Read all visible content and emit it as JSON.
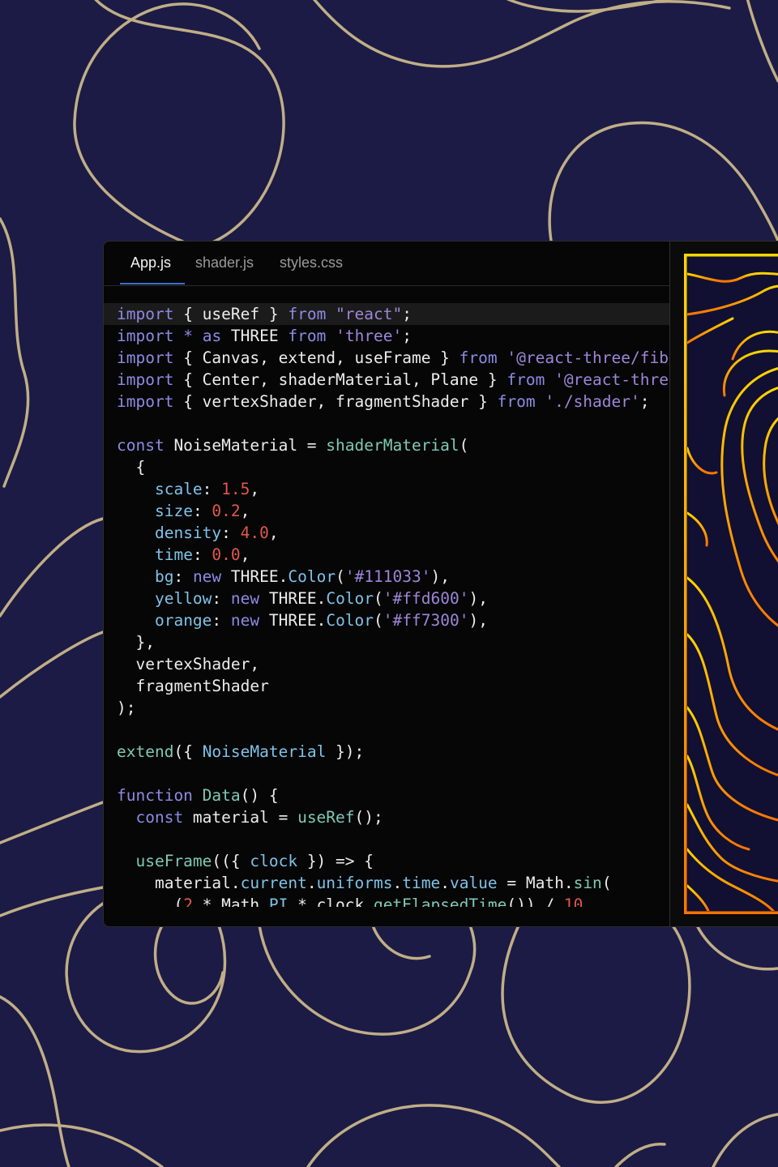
{
  "colors": {
    "background": "#1b1b45",
    "contour_line": "#c9b68a",
    "preview_bg": "#111033",
    "preview_yellow": "#ffd600",
    "preview_orange": "#ff7300"
  },
  "editor": {
    "tabs": [
      {
        "label": "App.js",
        "active": true
      },
      {
        "label": "shader.js",
        "active": false
      },
      {
        "label": "styles.css",
        "active": false
      }
    ],
    "code_lines": [
      [
        [
          "kw",
          "import"
        ],
        [
          "id",
          " { useRef } "
        ],
        [
          "kw",
          "from"
        ],
        [
          "id",
          " "
        ],
        [
          "str",
          "\"react\""
        ],
        [
          "id",
          ";"
        ]
      ],
      [
        [
          "kw",
          "import"
        ],
        [
          "id",
          " "
        ],
        [
          "kw",
          "*"
        ],
        [
          "id",
          " "
        ],
        [
          "kw",
          "as"
        ],
        [
          "id",
          " THREE "
        ],
        [
          "kw",
          "from"
        ],
        [
          "id",
          " "
        ],
        [
          "str",
          "'three'"
        ],
        [
          "id",
          ";"
        ]
      ],
      [
        [
          "kw",
          "import"
        ],
        [
          "id",
          " { Canvas, extend, useFrame } "
        ],
        [
          "kw",
          "from"
        ],
        [
          "id",
          " "
        ],
        [
          "str",
          "'@react-three/fiber'"
        ],
        [
          "id",
          ";"
        ]
      ],
      [
        [
          "kw",
          "import"
        ],
        [
          "id",
          " { Center, shaderMaterial, Plane } "
        ],
        [
          "kw",
          "from"
        ],
        [
          "id",
          " "
        ],
        [
          "str",
          "'@react-three/drei'"
        ],
        [
          "id",
          ";"
        ]
      ],
      [
        [
          "kw",
          "import"
        ],
        [
          "id",
          " { vertexShader, fragmentShader } "
        ],
        [
          "kw",
          "from"
        ],
        [
          "id",
          " "
        ],
        [
          "str",
          "'./shader'"
        ],
        [
          "id",
          ";"
        ]
      ],
      [],
      [
        [
          "kw",
          "const"
        ],
        [
          "id",
          " NoiseMaterial = "
        ],
        [
          "fn",
          "shaderMaterial"
        ],
        [
          "id",
          "("
        ]
      ],
      [
        [
          "id",
          "  {"
        ]
      ],
      [
        [
          "id",
          "    "
        ],
        [
          "prop",
          "scale"
        ],
        [
          "id",
          ": "
        ],
        [
          "num",
          "1.5"
        ],
        [
          "id",
          ","
        ]
      ],
      [
        [
          "id",
          "    "
        ],
        [
          "prop",
          "size"
        ],
        [
          "id",
          ": "
        ],
        [
          "num",
          "0.2"
        ],
        [
          "id",
          ","
        ]
      ],
      [
        [
          "id",
          "    "
        ],
        [
          "prop",
          "density"
        ],
        [
          "id",
          ": "
        ],
        [
          "num",
          "4.0"
        ],
        [
          "id",
          ","
        ]
      ],
      [
        [
          "id",
          "    "
        ],
        [
          "prop",
          "time"
        ],
        [
          "id",
          ": "
        ],
        [
          "num",
          "0.0"
        ],
        [
          "id",
          ","
        ]
      ],
      [
        [
          "id",
          "    "
        ],
        [
          "prop",
          "bg"
        ],
        [
          "id",
          ": "
        ],
        [
          "kw",
          "new"
        ],
        [
          "id",
          " THREE."
        ],
        [
          "prop",
          "Color"
        ],
        [
          "id",
          "("
        ],
        [
          "str",
          "'#111033'"
        ],
        [
          "id",
          "),"
        ]
      ],
      [
        [
          "id",
          "    "
        ],
        [
          "prop",
          "yellow"
        ],
        [
          "id",
          ": "
        ],
        [
          "kw",
          "new"
        ],
        [
          "id",
          " THREE."
        ],
        [
          "prop",
          "Color"
        ],
        [
          "id",
          "("
        ],
        [
          "str",
          "'#ffd600'"
        ],
        [
          "id",
          "),"
        ]
      ],
      [
        [
          "id",
          "    "
        ],
        [
          "prop",
          "orange"
        ],
        [
          "id",
          ": "
        ],
        [
          "kw",
          "new"
        ],
        [
          "id",
          " THREE."
        ],
        [
          "prop",
          "Color"
        ],
        [
          "id",
          "("
        ],
        [
          "str",
          "'#ff7300'"
        ],
        [
          "id",
          "),"
        ]
      ],
      [
        [
          "id",
          "  },"
        ]
      ],
      [
        [
          "id",
          "  vertexShader,"
        ]
      ],
      [
        [
          "id",
          "  fragmentShader"
        ]
      ],
      [
        [
          "id",
          ");"
        ]
      ],
      [],
      [
        [
          "fn",
          "extend"
        ],
        [
          "id",
          "({ "
        ],
        [
          "prop",
          "NoiseMaterial"
        ],
        [
          "id",
          " });"
        ]
      ],
      [],
      [
        [
          "kw",
          "function"
        ],
        [
          "id",
          " "
        ],
        [
          "fn",
          "Data"
        ],
        [
          "id",
          "() {"
        ]
      ],
      [
        [
          "id",
          "  "
        ],
        [
          "kw",
          "const"
        ],
        [
          "id",
          " material = "
        ],
        [
          "fn",
          "useRef"
        ],
        [
          "id",
          "();"
        ]
      ],
      [],
      [
        [
          "id",
          "  "
        ],
        [
          "fn",
          "useFrame"
        ],
        [
          "id",
          "(({ "
        ],
        [
          "prop",
          "clock"
        ],
        [
          "id",
          " }) => {"
        ]
      ],
      [
        [
          "id",
          "    material."
        ],
        [
          "prop",
          "current"
        ],
        [
          "id",
          "."
        ],
        [
          "prop",
          "uniforms"
        ],
        [
          "id",
          "."
        ],
        [
          "prop",
          "time"
        ],
        [
          "id",
          "."
        ],
        [
          "prop",
          "value"
        ],
        [
          "id",
          " = Math."
        ],
        [
          "fn",
          "sin"
        ],
        [
          "id",
          "("
        ]
      ],
      [
        [
          "id",
          "      ("
        ],
        [
          "num",
          "2"
        ],
        [
          "id",
          " * Math."
        ],
        [
          "prop",
          "PI"
        ],
        [
          "id",
          " * clock."
        ],
        [
          "fnu",
          "getElapsedTime"
        ],
        [
          "id",
          "()) / "
        ],
        [
          "num",
          "10"
        ]
      ]
    ]
  }
}
